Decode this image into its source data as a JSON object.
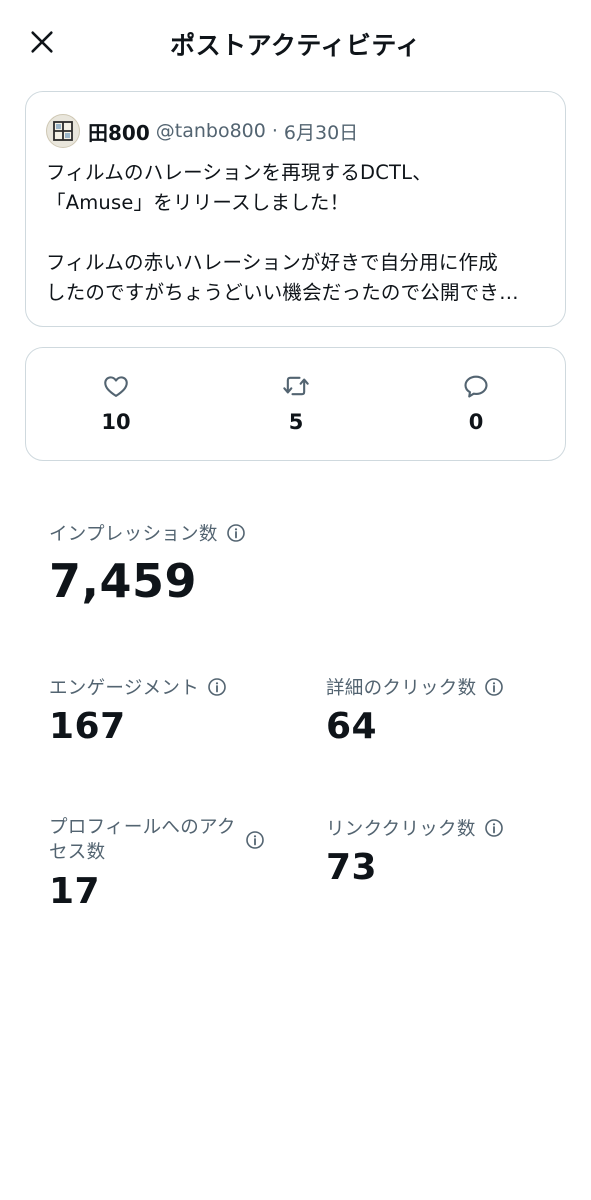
{
  "header": {
    "title": "ポストアクティビティ",
    "close_icon": "close-icon"
  },
  "post": {
    "author_name": "田800",
    "handle": "@tanbo800",
    "separator": "·",
    "date": "6月30日",
    "lines": [
      "フィルムのハレーションを再現するDCTL、",
      "「Amuse」をリリースしました！",
      "フィルムの赤いハレーションが好きで自分用に作成",
      "したのですがちょうどいい機会だったので公開でき…"
    ]
  },
  "engagement": {
    "likes": {
      "icon": "heart-icon",
      "count": "10"
    },
    "reposts": {
      "icon": "repost-icon",
      "count": "5"
    },
    "replies": {
      "icon": "reply-icon",
      "count": "0"
    }
  },
  "metrics": {
    "impressions": {
      "label": "インプレッション数",
      "value": "7,459"
    },
    "engagements": {
      "label": "エンゲージメント",
      "value": "167"
    },
    "detail_clicks": {
      "label": "詳細のクリック数",
      "value": "64"
    },
    "profile_visits": {
      "label_line1": "プロフィールへのアク",
      "label_line2": "セス数",
      "value": "17"
    },
    "link_clicks": {
      "label": "リンククリック数",
      "value": "73"
    }
  },
  "colors": {
    "text_primary": "#0f1419",
    "text_secondary": "#536471",
    "border": "#cfd9de",
    "background": "#ffffff"
  }
}
